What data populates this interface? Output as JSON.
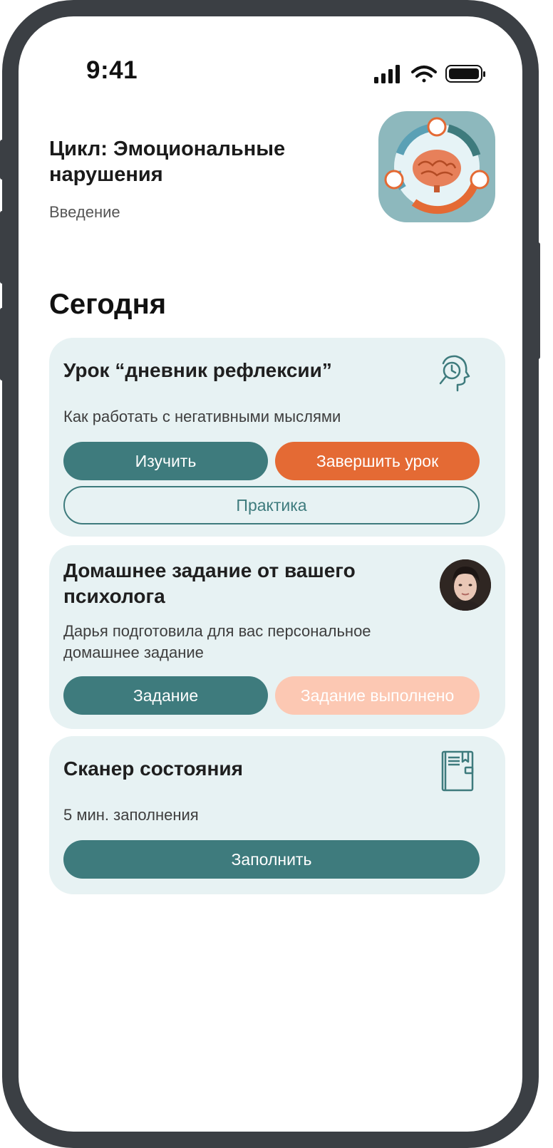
{
  "status_bar": {
    "time": "9:41"
  },
  "header": {
    "title": "Цикл: Эмоциональные нарушения",
    "subtitle": "Введение",
    "image_icon": "brain-cycle-icon"
  },
  "section": {
    "title": "Сегодня"
  },
  "cards": [
    {
      "title": "Урок “дневник рефлексии”",
      "text": "Как работать с негативными мыслями",
      "icon": "head-magnifier-icon",
      "buttons": {
        "study": "Изучить",
        "finish": "Завершить урок",
        "practice": "Практика"
      }
    },
    {
      "title": "Домашнее задание от вашего психолога",
      "text": " Дарья подготовила для вас персональное домашнее задание",
      "icon": "psychologist-avatar",
      "buttons": {
        "task": "Задание",
        "done": "Задание выполнено"
      }
    },
    {
      "title": "Сканер состояния",
      "text": "5 мин. заполнения",
      "icon": "notebook-icon",
      "buttons": {
        "fill": "Заполнить"
      }
    }
  ],
  "colors": {
    "teal": "#3e7b7d",
    "orange": "#e46a34",
    "orange_disabled": "#fcc8b3",
    "card_bg": "#e7f2f3",
    "frame": "#3b3f44"
  }
}
